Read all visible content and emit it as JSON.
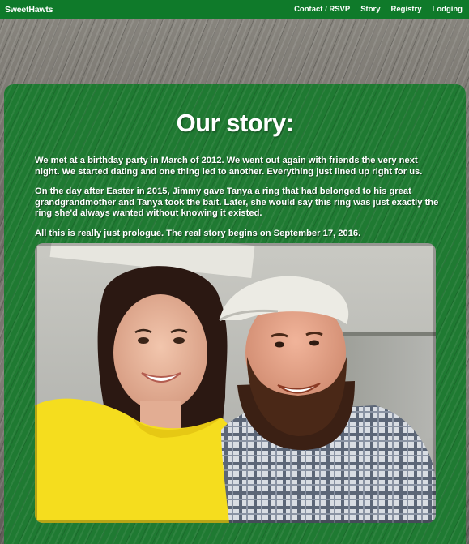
{
  "navbar": {
    "brand": "SweetHawts",
    "links": [
      "Contact / RSVP",
      "Story",
      "Registry",
      "Lodging"
    ]
  },
  "story": {
    "title": "Our story:",
    "paragraphs": [
      "We met at a birthday party in March of 2012. We went out again with friends the very next night. We started dating and one thing led to another. Everything just lined up right for us.",
      "On the day after Easter in 2015, Jimmy gave Tanya a ring that had belonged to his great grandgrandmother and Tanya took the bait. Later, she would say this ring was just exactly the ring she'd always wanted without knowing it existed.",
      "All this is really just prologue. The real story begins on September 17, 2016."
    ]
  },
  "colors": {
    "navbar": "#0f7a2a",
    "panel": "#1f7a32",
    "text": "#ffffff"
  }
}
